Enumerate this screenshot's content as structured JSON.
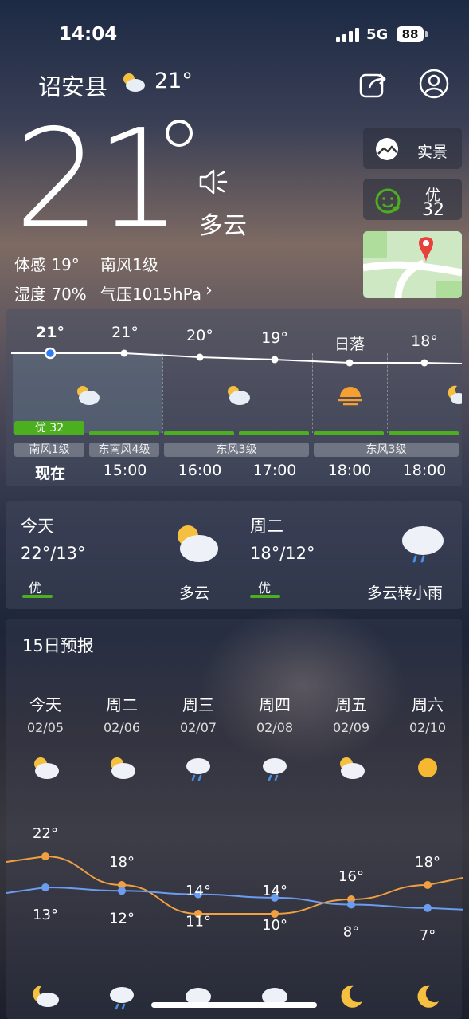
{
  "status": {
    "time": "14:04",
    "network": "5G",
    "battery": "88"
  },
  "header": {
    "city": "诏安县",
    "temp": "21°"
  },
  "current": {
    "temp": "21",
    "condition": "多云",
    "feels_like": "体感 19°",
    "wind": "南风1级",
    "humidity": "湿度 70%",
    "pressure": "气压1015hPa",
    "live_label": "实景",
    "aqi_quality": "优",
    "aqi_value": "32"
  },
  "hourly": {
    "temps": [
      "21°",
      "21°",
      "20°",
      "19°",
      "日落",
      "18°"
    ],
    "times": [
      "现在",
      "15:00",
      "16:00",
      "17:00",
      "18:00",
      "18:00"
    ],
    "aqi_badge": "优 32",
    "winds": [
      "南风1级",
      "东南风4级",
      "东风3级",
      "东风3级"
    ]
  },
  "two_day": {
    "today": {
      "title": "今天",
      "range": "22°/13°",
      "aqi": "优",
      "condition": "多云"
    },
    "tomorrow": {
      "title": "周二",
      "range": "18°/12°",
      "aqi": "优",
      "condition": "多云转小雨"
    }
  },
  "forecast": {
    "title": "15日预报",
    "days": [
      "今天",
      "周二",
      "周三",
      "周四",
      "周五",
      "周六"
    ],
    "dates": [
      "02/05",
      "02/06",
      "02/07",
      "02/08",
      "02/09",
      "02/10"
    ],
    "highs": [
      "22°",
      "18°",
      "14°",
      "14°",
      "16°",
      "18°"
    ],
    "lows": [
      "13°",
      "12°",
      "11°",
      "10°",
      "8°",
      "7°"
    ],
    "high_values": [
      22,
      18,
      14,
      14,
      16,
      18
    ],
    "low_values": [
      13,
      12,
      11,
      10,
      8,
      7
    ],
    "day_icons": [
      "partly-cloudy-icon",
      "partly-cloudy-icon",
      "rain-icon",
      "light-rain-icon",
      "partly-cloudy-icon",
      "sunny-icon"
    ],
    "night_icons": [
      "cloudy-night-icon",
      "rain-icon",
      "cloudy-icon",
      "cloudy-icon",
      "moon-icon",
      "moon-icon"
    ]
  },
  "colors": {
    "high_line": "#f0a040",
    "low_line": "#6b9cf0",
    "aqi_green": "#4caf20"
  }
}
